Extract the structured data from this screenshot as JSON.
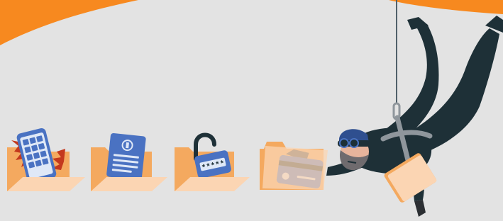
{
  "illustration": {
    "folders": [
      {
        "name": "folder-phone",
        "item": "smartphone-icon"
      },
      {
        "name": "folder-document",
        "item": "document-icon"
      },
      {
        "name": "folder-password",
        "item": "padlock-icon"
      },
      {
        "name": "folder-credit-card",
        "item": "credit-card-icon"
      }
    ],
    "hacker": {
      "carrying": "stolen-folder",
      "hanging_from": "rope"
    },
    "padlock": {
      "password_mask": "*****"
    },
    "colors": {
      "background": "#e3e3e3",
      "accent_orange": "#f7891f",
      "folder_back": "#f4a95f",
      "folder_front": "#fbd5b3",
      "item_blue": "#4a72c2",
      "suit_dark": "#1e3037",
      "harness_grey": "#8f969c",
      "skin": "#e7b49c",
      "beard": "#6f6b6e",
      "alert_red": "#c4391e"
    }
  }
}
